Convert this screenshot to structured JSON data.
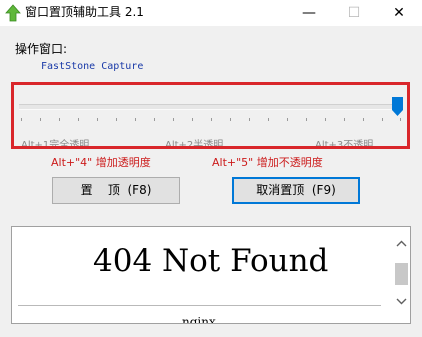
{
  "window": {
    "title": "窗口置顶辅助工具 2.1",
    "icon": "green-up-arrow-icon",
    "controls": {
      "minimize": "—",
      "maximize": "☐",
      "close": "✕"
    }
  },
  "target": {
    "label": "操作窗口:",
    "window_name": "FastStone Capture"
  },
  "opacity_slider": {
    "value_fraction": 1.0,
    "tick_labels": [
      "Alt+1完全透明",
      "Alt+2半透明",
      "Alt+3不透明"
    ],
    "hints": [
      "Alt+\"4\" 增加透明度",
      "Alt+\"5\" 增加不透明度"
    ]
  },
  "buttons": {
    "pin": "置    顶  (F8)",
    "unpin": "取消置顶  (F9)"
  },
  "web_view": {
    "heading": "404 Not Found",
    "footer": "nginx"
  },
  "colors": {
    "highlight": "#d9262b",
    "hint_text": "#cc1b1b",
    "window_name_text": "#1a3aa8",
    "default_button_border": "#0078d7"
  }
}
